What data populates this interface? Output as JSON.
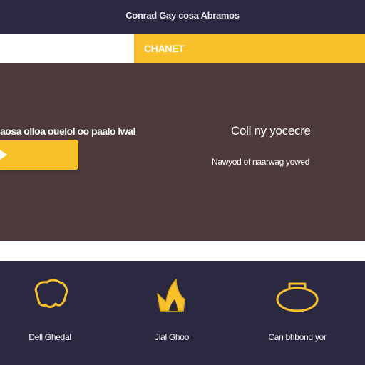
{
  "header": {
    "title": "Conrad Gay cosa Abramos"
  },
  "nav": {
    "active_tab": "CHANET"
  },
  "hero": {
    "left_text": "aosa olloa ouelol oo paalo lwal",
    "title": "Coll ny yocecre",
    "subtitle": "Nawyod of naarwag yowed"
  },
  "features": [
    {
      "icon": "shield-icon",
      "label": "Dell Ghedal"
    },
    {
      "icon": "flame-icon",
      "label": "Jial Ghoo"
    },
    {
      "icon": "ring-icon",
      "label": "Can bhbond yor"
    }
  ],
  "colors": {
    "navy": "#2b2842",
    "accent": "#f8c12c",
    "hero_bg": "#4d3a3a",
    "white": "#ffffff"
  }
}
